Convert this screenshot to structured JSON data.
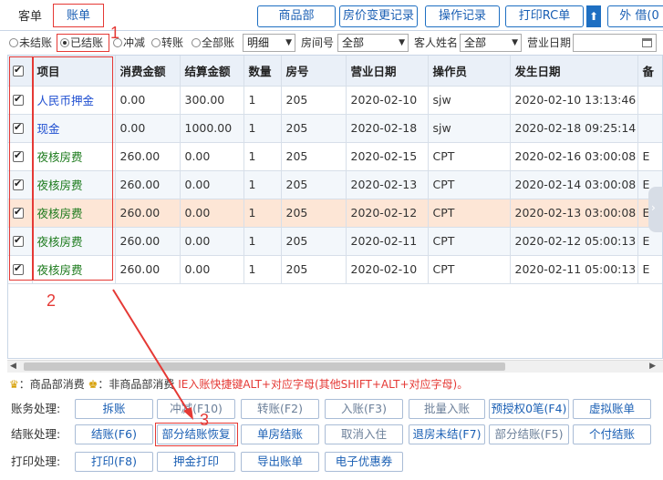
{
  "tabs": [
    {
      "label": "客单"
    },
    {
      "label": "账单"
    }
  ],
  "toolbar": {
    "goods_dept": "商品部",
    "price_change_log": "房价变更记录",
    "operation_log": "操作记录",
    "print_rc": "打印RC单",
    "up_arrow": "⬆",
    "external": "外 借(0"
  },
  "filters": {
    "radios": [
      "未结账",
      "已结账",
      "冲减",
      "转账",
      "全部账"
    ],
    "selected_radio": "已结账",
    "detail_select": "明细",
    "room_label": "房间号",
    "room_select": "全部",
    "guest_label": "客人姓名",
    "guest_select": "全部",
    "date_label": "营业日期",
    "date_value": ""
  },
  "table": {
    "columns": [
      "项目",
      "消费金额",
      "结算金额",
      "数量",
      "房号",
      "营业日期",
      "操作员",
      "发生日期",
      "备"
    ],
    "rows": [
      {
        "item": "人民币押金",
        "consume": "0.00",
        "settle": "300.00",
        "qty": "1",
        "room": "205",
        "biz_date": "2020-02-10",
        "operator": "sjw",
        "occur": "2020-02-10 13:13:46",
        "extra": ""
      },
      {
        "item": "现金",
        "consume": "0.00",
        "settle": "1000.00",
        "qty": "1",
        "room": "205",
        "biz_date": "2020-02-18",
        "operator": "sjw",
        "occur": "2020-02-18 09:25:14",
        "extra": ""
      },
      {
        "item": "夜核房费",
        "consume": "260.00",
        "settle": "0.00",
        "qty": "1",
        "room": "205",
        "biz_date": "2020-02-15",
        "operator": "CPT",
        "occur": "2020-02-16 03:00:08",
        "extra": "E"
      },
      {
        "item": "夜核房费",
        "consume": "260.00",
        "settle": "0.00",
        "qty": "1",
        "room": "205",
        "biz_date": "2020-02-13",
        "operator": "CPT",
        "occur": "2020-02-14 03:00:08",
        "extra": "E"
      },
      {
        "item": "夜核房费",
        "consume": "260.00",
        "settle": "0.00",
        "qty": "1",
        "room": "205",
        "biz_date": "2020-02-12",
        "operator": "CPT",
        "occur": "2020-02-13 03:00:08",
        "extra": "E"
      },
      {
        "item": "夜核房费",
        "consume": "260.00",
        "settle": "0.00",
        "qty": "1",
        "room": "205",
        "biz_date": "2020-02-11",
        "operator": "CPT",
        "occur": "2020-02-12 05:00:13",
        "extra": "E"
      },
      {
        "item": "夜核房费",
        "consume": "260.00",
        "settle": "0.00",
        "qty": "1",
        "room": "205",
        "biz_date": "2020-02-10",
        "operator": "CPT",
        "occur": "2020-02-11 05:00:13",
        "extra": "E"
      }
    ]
  },
  "legend": {
    "goods_dept": "：商品部消费",
    "non_goods_dept": "：非商品部消费",
    "hint": "IE入账快捷键ALT+对应字母(其他SHIFT+ALT+对应字母)。"
  },
  "actions": {
    "account_label": "账务处理:",
    "account_buttons": [
      "拆账",
      "冲减(F10)",
      "转账(F2)",
      "入账(F3)",
      "批量入账",
      "预授权0笔(F4)",
      "虚拟账单"
    ],
    "checkout_label": "结账处理:",
    "checkout_buttons": [
      "结账(F6)",
      "部分结账恢复",
      "单房结账",
      "取消入住",
      "退房未结(F7)",
      "部分结账(F5)",
      "个付结账"
    ],
    "print_label": "打印处理:",
    "print_buttons": [
      "打印(F8)",
      "押金打印",
      "导出账单",
      "电子优惠券"
    ]
  },
  "annotations": [
    "1",
    "2",
    "3"
  ],
  "colors": {
    "accent": "#1e6fc2",
    "annotation_red": "#e53935",
    "header_bg": "#eaf0f8",
    "selected_row": "#fde6d6"
  }
}
